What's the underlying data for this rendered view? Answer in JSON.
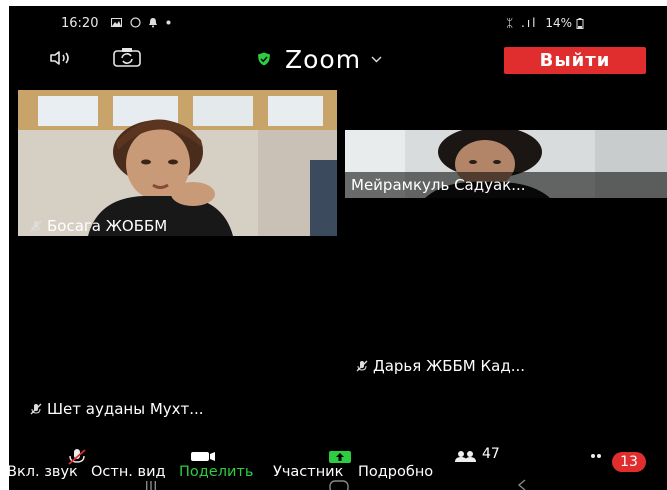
{
  "status_bar": {
    "time": "16:20",
    "notification_icons": [
      "gallery-icon",
      "whatsapp-icon",
      "bell-icon",
      "dot-icon"
    ],
    "signal": "ᛯ .ıl",
    "battery": "14%"
  },
  "top_bar": {
    "app_title": "Zoom",
    "leave_label": "Выйти"
  },
  "participants": [
    {
      "name": "Босага ЖОББМ"
    },
    {
      "name": "Мейрамкуль Садуак..."
    },
    {
      "name": "Дарья ЖББМ Кад..."
    },
    {
      "name": "Шет ауданы Мухт..."
    }
  ],
  "toolbar": {
    "items": [
      {
        "label": "Вкл. звук",
        "icon": "muted-mic-icon"
      },
      {
        "label": "Остн. вид",
        "icon": "video-camera-icon"
      },
      {
        "label": "Поделить",
        "icon": "share-arrow-icon"
      },
      {
        "label": "Участник",
        "icon": "participants-icon",
        "count": "47"
      },
      {
        "label": "Подробно",
        "icon": "more-dots-icon",
        "badge": "13"
      }
    ]
  },
  "colors": {
    "background": "#000000",
    "leave_button": "#e02e2e",
    "share_green": "#2ecc40",
    "shield_green": "#2ecc40"
  }
}
